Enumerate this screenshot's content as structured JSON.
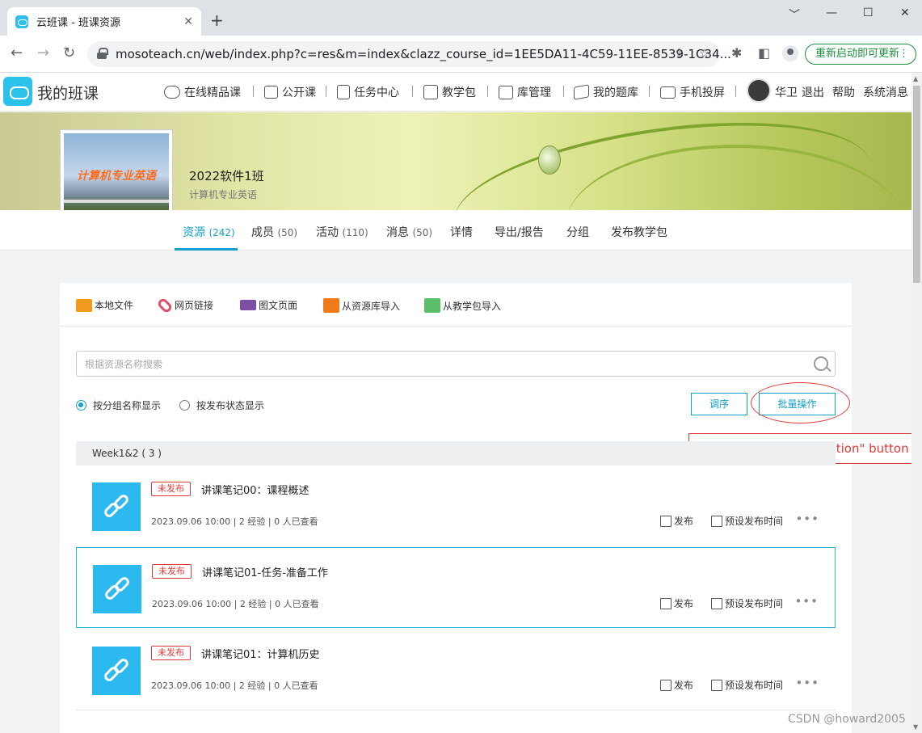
{
  "browser": {
    "tab_title": "云班课 - 班课资源",
    "tab_close": "✕",
    "new_tab": "+",
    "win_min": "﹀",
    "win_minimize": "—",
    "win_max": "☐",
    "win_close": "✕",
    "url": "mosoteach.cn/web/index.php?c=res&m=index&clazz_course_id=1EE5DA11-4C59-11EE-8539-1C34...",
    "update_label": "重新启动即可更新",
    "update_dots": "⋮"
  },
  "header": {
    "site_title": "我的班课",
    "nav": [
      "在线精品课",
      "公开课",
      "任务中心",
      "教学包",
      "库管理",
      "我的题库",
      "手机投屏"
    ],
    "user_name": "华卫",
    "logout": "退出",
    "help": "帮助",
    "messages": "系统消息"
  },
  "course": {
    "cover_text": "计算机专业英语",
    "class_name": "2022软件1班",
    "course_name": "计算机专业英语"
  },
  "tabs": [
    {
      "label": "资源",
      "count": "(242)"
    },
    {
      "label": "成员",
      "count": "(50)"
    },
    {
      "label": "活动",
      "count": "(110)"
    },
    {
      "label": "消息",
      "count": "(50)"
    },
    {
      "label": "详情",
      "count": ""
    },
    {
      "label": "导出/报告",
      "count": ""
    },
    {
      "label": "分组",
      "count": ""
    },
    {
      "label": "发布教学包",
      "count": ""
    }
  ],
  "upload": {
    "local_file": "本地文件",
    "web_link": "网页链接",
    "rich_page": "图文页面",
    "from_library": "从资源库导入",
    "from_package": "从教学包导入"
  },
  "search": {
    "placeholder": "根据资源名称搜索"
  },
  "view": {
    "by_group": "按分组名称显示",
    "by_status": "按发布状态显示",
    "reorder": "调序",
    "batch": "批量操作"
  },
  "annotation": {
    "text": "click the \"Batch Operation\" button"
  },
  "group": {
    "title": "Week1&2 ( 3 )"
  },
  "resources": [
    {
      "status": "未发布",
      "title": "讲课笔记00：课程概述",
      "meta": "2023.09.06 10:00 | 2 经验 | 0 人已查看",
      "publish": "发布",
      "schedule": "预设发布时间",
      "more": "•••"
    },
    {
      "status": "未发布",
      "title": "讲课笔记01-任务-准备工作",
      "meta": "2023.09.06 10:00 | 2 经验 | 0 人已查看",
      "publish": "发布",
      "schedule": "预设发布时间",
      "more": "•••"
    },
    {
      "status": "未发布",
      "title": "讲课笔记01：计算机历史",
      "meta": "2023.09.06 10:00 | 2 经验 | 0 人已查看",
      "publish": "发布",
      "schedule": "预设发布时间",
      "more": "•••"
    }
  ],
  "watermark": "CSDN @howard2005",
  "colors": {
    "accent": "#12a0c8",
    "status_red": "#e03b3b",
    "thumb_blue": "#2cb9f0"
  }
}
